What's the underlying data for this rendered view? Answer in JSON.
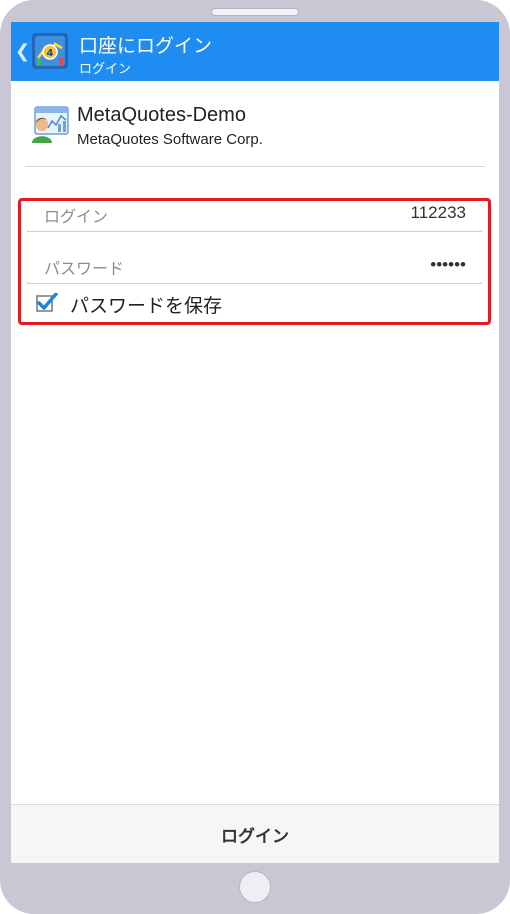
{
  "header": {
    "title": "口座にログイン",
    "subtitle": "ログイン",
    "back_icon": "chevron-left-icon",
    "app_icon": "metatrader-app-icon",
    "color": "#1f8cf2"
  },
  "server": {
    "name": "MetaQuotes-Demo",
    "company": "MetaQuotes Software Corp.",
    "icon": "server-broker-icon"
  },
  "form": {
    "highlight_color": "#e21a22",
    "login_label": "ログイン",
    "login_value": "112233",
    "password_label": "パスワード",
    "password_value": "••••••",
    "save_password_label": "パスワードを保存",
    "save_password_checked": true
  },
  "footer": {
    "login_button_label": "ログイン"
  }
}
